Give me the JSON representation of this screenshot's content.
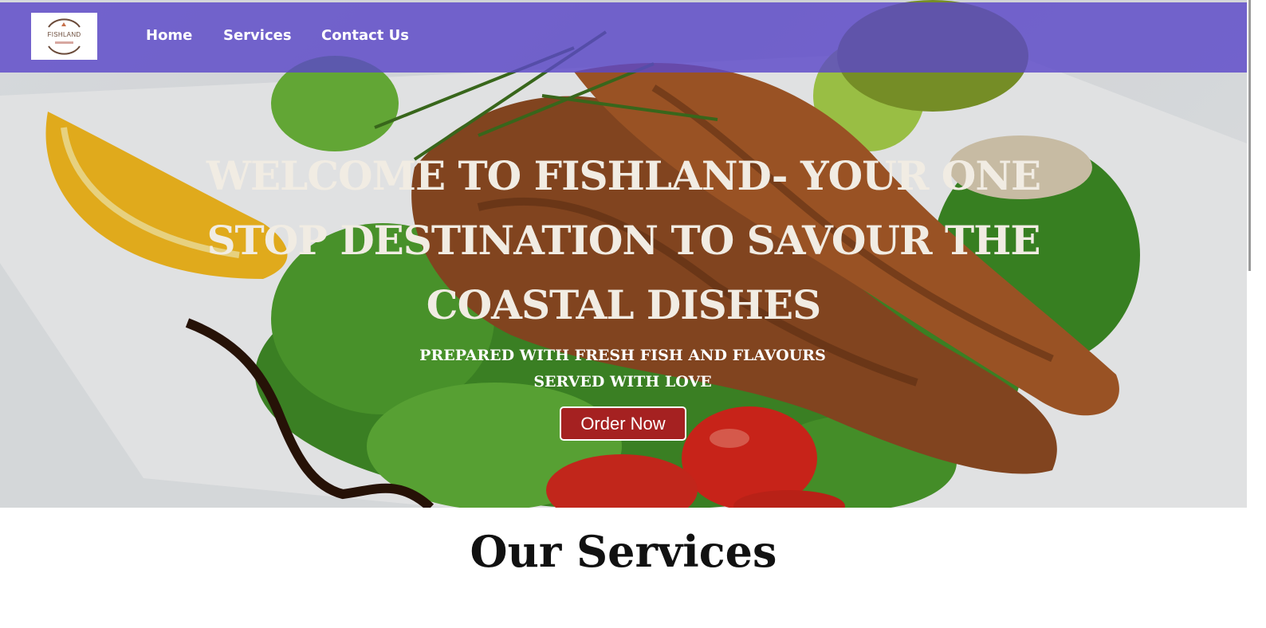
{
  "nav": {
    "logo_text": "FISHLAND",
    "links": [
      "Home",
      "Services",
      "Contact Us"
    ]
  },
  "hero": {
    "title": "WELCOME TO FISHLAND- YOUR ONE STOP DESTINATION TO SAVOUR THE COASTAL DISHES",
    "subtitle_line1": "PREPARED WITH FRESH FISH AND FLAVOURS",
    "subtitle_line2": "SERVED WITH LOVE",
    "button": "Order Now"
  },
  "services": {
    "title": "Our Services"
  },
  "colors": {
    "navbar": "#5c48c8",
    "button": "#a52121",
    "hero_text": "#f1ece3"
  }
}
